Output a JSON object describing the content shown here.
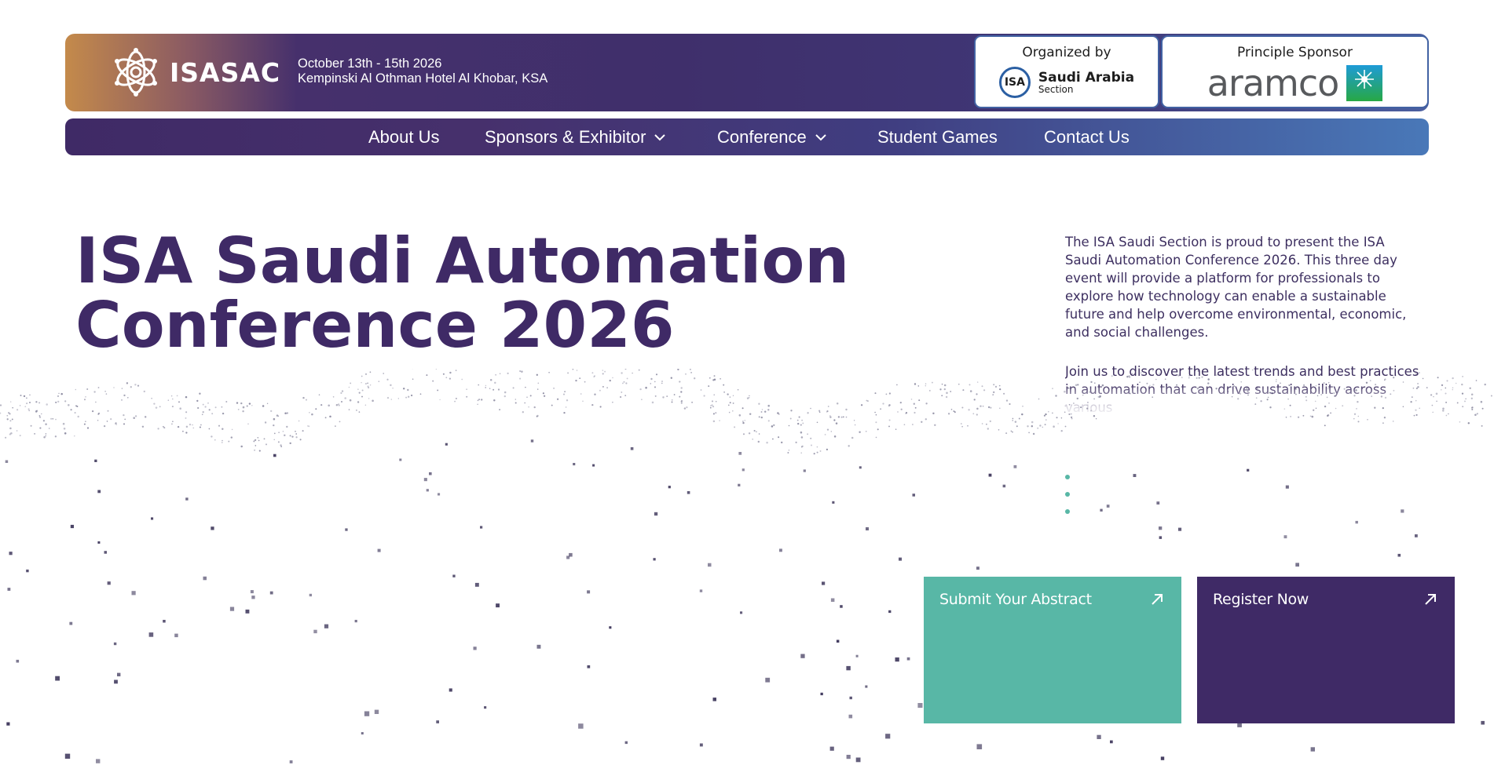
{
  "header": {
    "logo_text": "ISASAC",
    "event_date": "October 13th - 15th 2026",
    "event_location": "Kempinski Al Othman Hotel Al Khobar, KSA",
    "organizer": {
      "title": "Organized by",
      "logo_mark": "ISA",
      "logo_line1": "Saudi Arabia",
      "logo_line2": "Section"
    },
    "sponsor": {
      "title": "Principle Sponsor",
      "logo_word": "aramco"
    }
  },
  "nav": {
    "items": [
      {
        "label": "About Us",
        "dropdown": false
      },
      {
        "label": "Sponsors & Exhibitor",
        "dropdown": true
      },
      {
        "label": "Conference",
        "dropdown": true
      },
      {
        "label": "Student Games",
        "dropdown": false
      },
      {
        "label": "Contact Us",
        "dropdown": false
      }
    ]
  },
  "hero": {
    "title_line1": "ISA Saudi Automation",
    "title_line2": "Conference 2026",
    "intro_p1": "The ISA Saudi Section is proud to present the ISA Saudi Automation Conference 2026. This three day event will provide a platform for professionals to explore how technology can enable a sustainable future and help overcome environmental, economic, and social challenges.",
    "intro_p2": "Join us to discover the latest trends and best practices in automation that can drive sustainability across various"
  },
  "cta": {
    "abstract_label": "Submit Your Abstract",
    "register_label": "Register Now"
  },
  "colors": {
    "brand_purple": "#3f2a66",
    "accent_teal": "#58b7a6",
    "nav_blue": "#4978b8",
    "header_gold": "#c48a4b"
  },
  "icons": {
    "logo": "isasac-knot-logo",
    "chevron": "chevron-down-icon",
    "arrow": "arrow-up-right-icon"
  }
}
